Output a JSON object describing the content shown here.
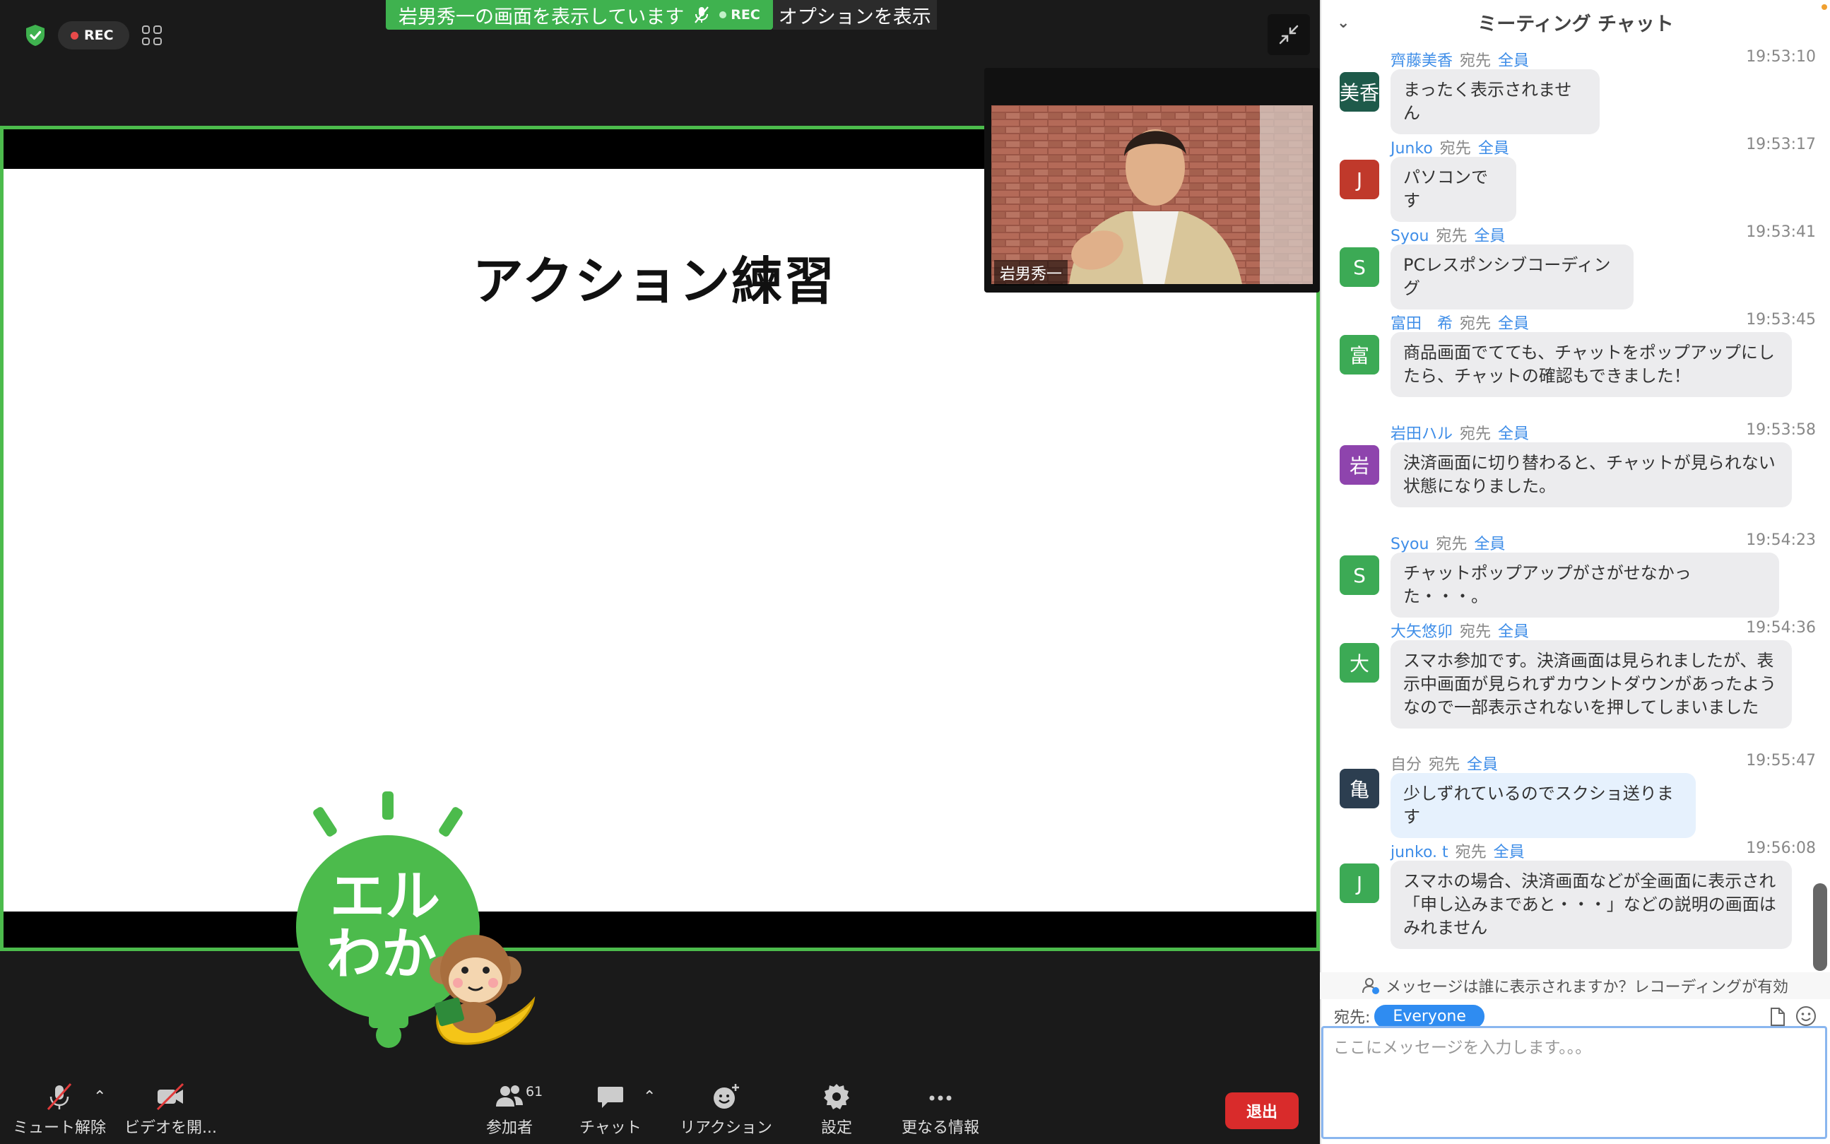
{
  "share_banner": {
    "text": "岩男秀一の画面を表示しています",
    "rec": "REC",
    "options": "オプションを表示"
  },
  "top_left": {
    "rec": "REC"
  },
  "slide": {
    "title": "アクション練習"
  },
  "logo": {
    "line1": "エル",
    "line2": "わか"
  },
  "video": {
    "name": "岩男秀一"
  },
  "toolbar": {
    "unmute": "ミュート解除",
    "video": "ビデオを開...",
    "participants": "参加者",
    "participants_count": "61",
    "chat": "チャット",
    "reactions": "リアクション",
    "settings": "設定",
    "more": "更なる情報",
    "leave": "退出"
  },
  "chat": {
    "title": "ミーティング チャット",
    "to_word": "宛先",
    "all": "全員",
    "messages": [
      {
        "avatar": "美香",
        "avatar_color": "#1e5a4a",
        "sender": "齊藤美香",
        "time": "19:53:10",
        "text": "まったく表示されません"
      },
      {
        "avatar": "J",
        "avatar_color": "#c0392b",
        "sender": "Junko",
        "time": "19:53:17",
        "text": "パソコンです"
      },
      {
        "avatar": "S",
        "avatar_color": "#3caa55",
        "sender": "Syou",
        "time": "19:53:41",
        "text": "PCレスポンシブコーディング"
      },
      {
        "avatar": "富",
        "avatar_color": "#3caa55",
        "sender": "富田　希",
        "time": "19:53:45",
        "text": "商品画面でてても、チャットをポップアップにしたら、チャットの確認もできました！"
      },
      {
        "avatar": "岩",
        "avatar_color": "#8e44ad",
        "sender": "岩田ハル",
        "time": "19:53:58",
        "text": "決済画面に切り替わると、チャットが見られない状態になりました。"
      },
      {
        "avatar": "S",
        "avatar_color": "#3caa55",
        "sender": "Syou",
        "time": "19:54:23",
        "text": "チャットポップアップがさがせなかった・・・。"
      },
      {
        "avatar": "大",
        "avatar_color": "#3caa55",
        "sender": "大矢悠卯",
        "time": "19:54:36",
        "text": "スマホ参加です。決済画面は見られましたが、表示中画面が見られずカウントダウンがあったようなので一部表示されないを押してしまいました"
      },
      {
        "avatar": "亀",
        "avatar_color": "#2c3e50",
        "sender": "自分",
        "time": "19:55:47",
        "text": "少しずれているのでスクショ送ります",
        "mine": true
      },
      {
        "avatar": "J",
        "avatar_color": "#3caa55",
        "sender": "junko. t",
        "time": "19:56:08",
        "text": "スマホの場合、決済画面などが全画面に表示され「申し込みまであと・・・」などの説明の画面はみれません"
      }
    ],
    "visibility_note": "メッセージは誰に表示されますか？レコーディングが有効",
    "to_label": "宛先:",
    "to_value": "Everyone",
    "input_placeholder": "ここにメッセージを入力します。。。"
  },
  "colors": {
    "accent_green": "#4cbb4c",
    "chat_blue": "#3f8ee8",
    "leave_red": "#d92b2b"
  }
}
